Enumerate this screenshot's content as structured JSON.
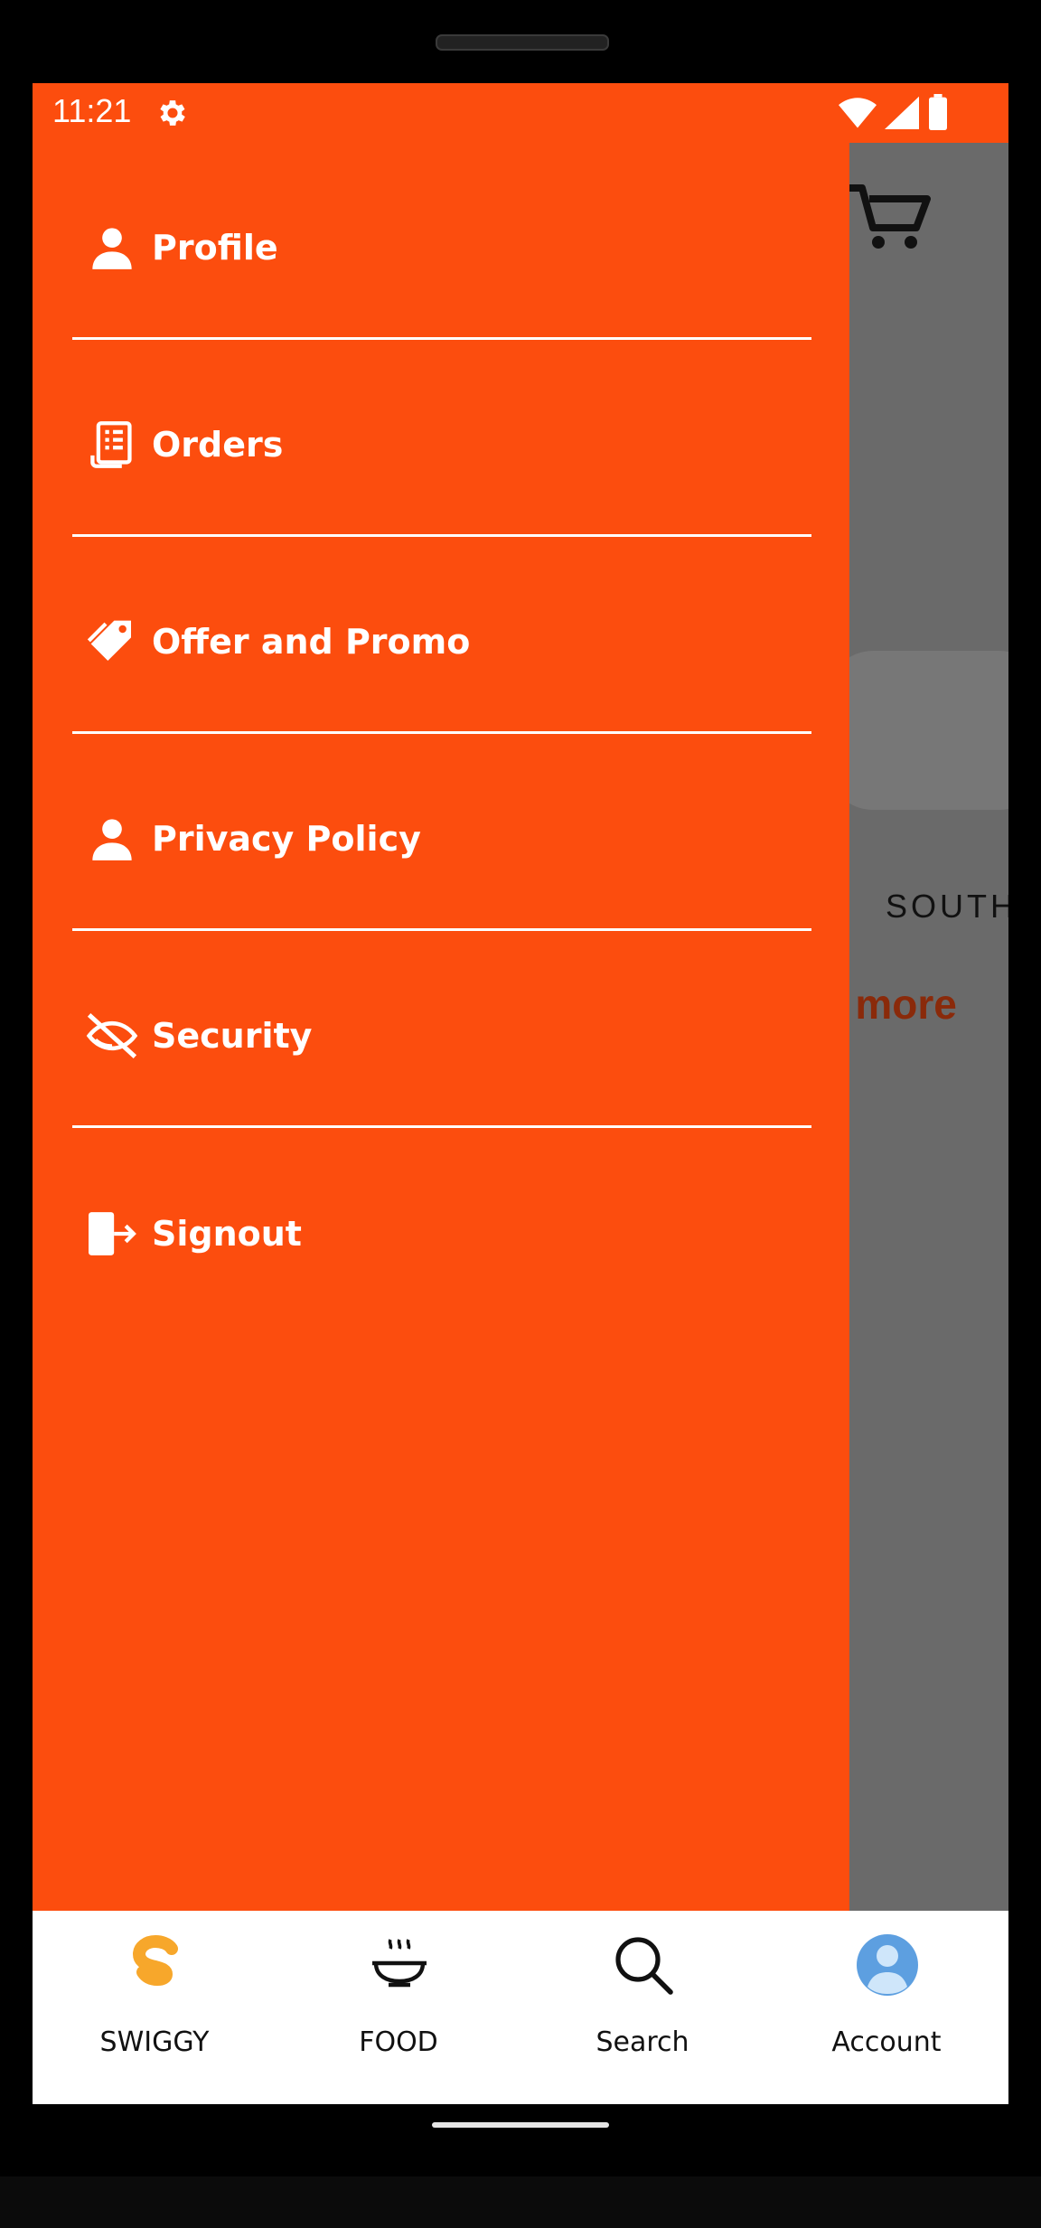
{
  "status_bar": {
    "time": "11:21"
  },
  "background": {
    "category": "SOUTH",
    "see_more": "e more"
  },
  "drawer": {
    "items": [
      {
        "label": "Profile",
        "icon": "person-icon"
      },
      {
        "label": "Orders",
        "icon": "receipt-icon"
      },
      {
        "label": "Offer and Promo",
        "icon": "tag-icon"
      },
      {
        "label": "Privacy Policy",
        "icon": "person-icon"
      },
      {
        "label": "Security",
        "icon": "eye-off-icon"
      },
      {
        "label": "Signout",
        "icon": "signout-icon"
      }
    ]
  },
  "bottom_nav": {
    "items": [
      {
        "label": "SWIGGY",
        "icon": "swiggy-logo-icon"
      },
      {
        "label": "FOOD",
        "icon": "food-bowl-icon"
      },
      {
        "label": "Search",
        "icon": "search-icon"
      },
      {
        "label": "Account",
        "icon": "account-avatar-icon"
      }
    ]
  },
  "colors": {
    "accent": "#fc4d0e",
    "overlay": "#6a6a6a",
    "nav_background": "#ffffff"
  }
}
